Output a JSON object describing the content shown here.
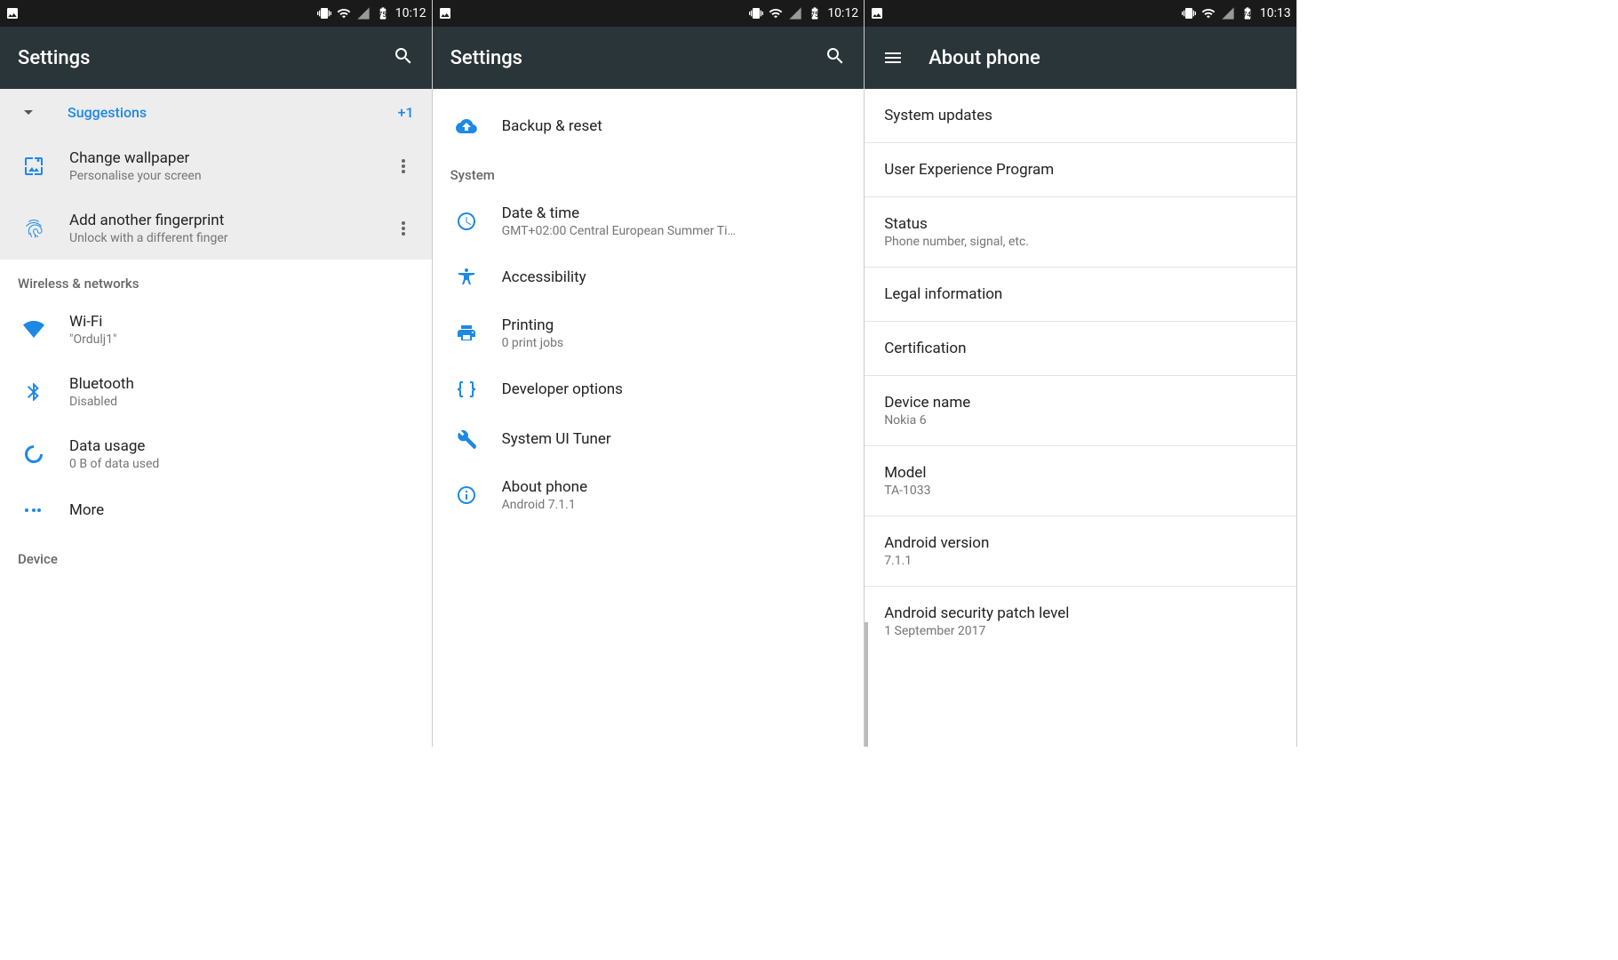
{
  "screen1": {
    "time": "10:12",
    "battery": "75",
    "title": "Settings",
    "suggestions_label": "Suggestions",
    "suggestions_badge": "+1",
    "sugg1_title": "Change wallpaper",
    "sugg1_sub": "Personalise your screen",
    "sugg2_title": "Add another fingerprint",
    "sugg2_sub": "Unlock with a different finger",
    "section_wireless": "Wireless & networks",
    "wifi_title": "Wi-Fi",
    "wifi_sub": "\"Ordulj1\"",
    "bt_title": "Bluetooth",
    "bt_sub": "Disabled",
    "data_title": "Data usage",
    "data_sub": "0 B of data used",
    "more_title": "More",
    "section_device": "Device"
  },
  "screen2": {
    "time": "10:12",
    "battery": "75",
    "title": "Settings",
    "backup_title": "Backup & reset",
    "section_system": "System",
    "date_title": "Date & time",
    "date_sub": "GMT+02:00 Central European Summer Ti…",
    "acc_title": "Accessibility",
    "print_title": "Printing",
    "print_sub": "0 print jobs",
    "dev_title": "Developer options",
    "tuner_title": "System UI Tuner",
    "about_title": "About phone",
    "about_sub": "Android 7.1.1"
  },
  "screen3": {
    "time": "10:13",
    "battery": "74",
    "title": "About phone",
    "updates": "System updates",
    "uxp": "User Experience Program",
    "status_title": "Status",
    "status_sub": "Phone number, signal, etc.",
    "legal": "Legal information",
    "cert": "Certification",
    "devname_title": "Device name",
    "devname_sub": "Nokia 6",
    "model_title": "Model",
    "model_sub": "TA-1033",
    "ver_title": "Android version",
    "ver_sub": "7.1.1",
    "patch_title": "Android security patch level",
    "patch_sub": "1 September 2017"
  }
}
